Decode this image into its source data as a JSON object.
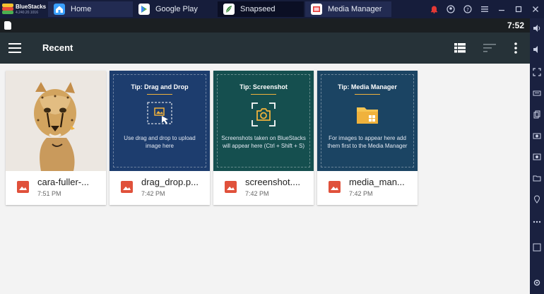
{
  "window": {
    "brand_name": "BlueStacks",
    "brand_version": "4.240.20.1016",
    "tabs": [
      {
        "label": "Home",
        "icon": "home-icon"
      },
      {
        "label": "Google Play",
        "icon": "google-play-icon"
      },
      {
        "label": "Snapseed",
        "icon": "snapseed-icon"
      },
      {
        "label": "Media Manager",
        "icon": "media-manager-icon"
      }
    ]
  },
  "status_bar": {
    "time": "7:52"
  },
  "app_bar": {
    "title": "Recent"
  },
  "files": [
    {
      "name": "cara-fuller-...",
      "time": "7:51 PM",
      "kind": "photo",
      "icon": "image-file-icon"
    },
    {
      "name": "drag_drop.p...",
      "time": "7:42 PM",
      "kind": "tip",
      "icon": "image-file-icon",
      "tip_title": "Tip: Drag and Drop",
      "tip_text": "Use drag and drop to upload image here",
      "tip_icon": "drag-drop-icon"
    },
    {
      "name": "screenshot....",
      "time": "7:42 PM",
      "kind": "tip",
      "icon": "image-file-icon",
      "tip_title": "Tip: Screenshot",
      "tip_text": "Screenshots taken on BlueStacks will appear here (Ctrl + Shift + S)",
      "tip_icon": "camera-icon"
    },
    {
      "name": "media_man...",
      "time": "7:42 PM",
      "kind": "tip",
      "icon": "image-file-icon",
      "tip_title": "Tip: Media Manager",
      "tip_text": "For images to appear here add them first to the Media Manager",
      "tip_icon": "folder-icon"
    }
  ],
  "colors": {
    "title_bar": "#161d3b",
    "app_bar": "#263238",
    "tip_blue": "#1d3d6e",
    "tip_teal": "#154f4f",
    "accent": "#f0b23c",
    "file_icon": "#e0513b"
  }
}
